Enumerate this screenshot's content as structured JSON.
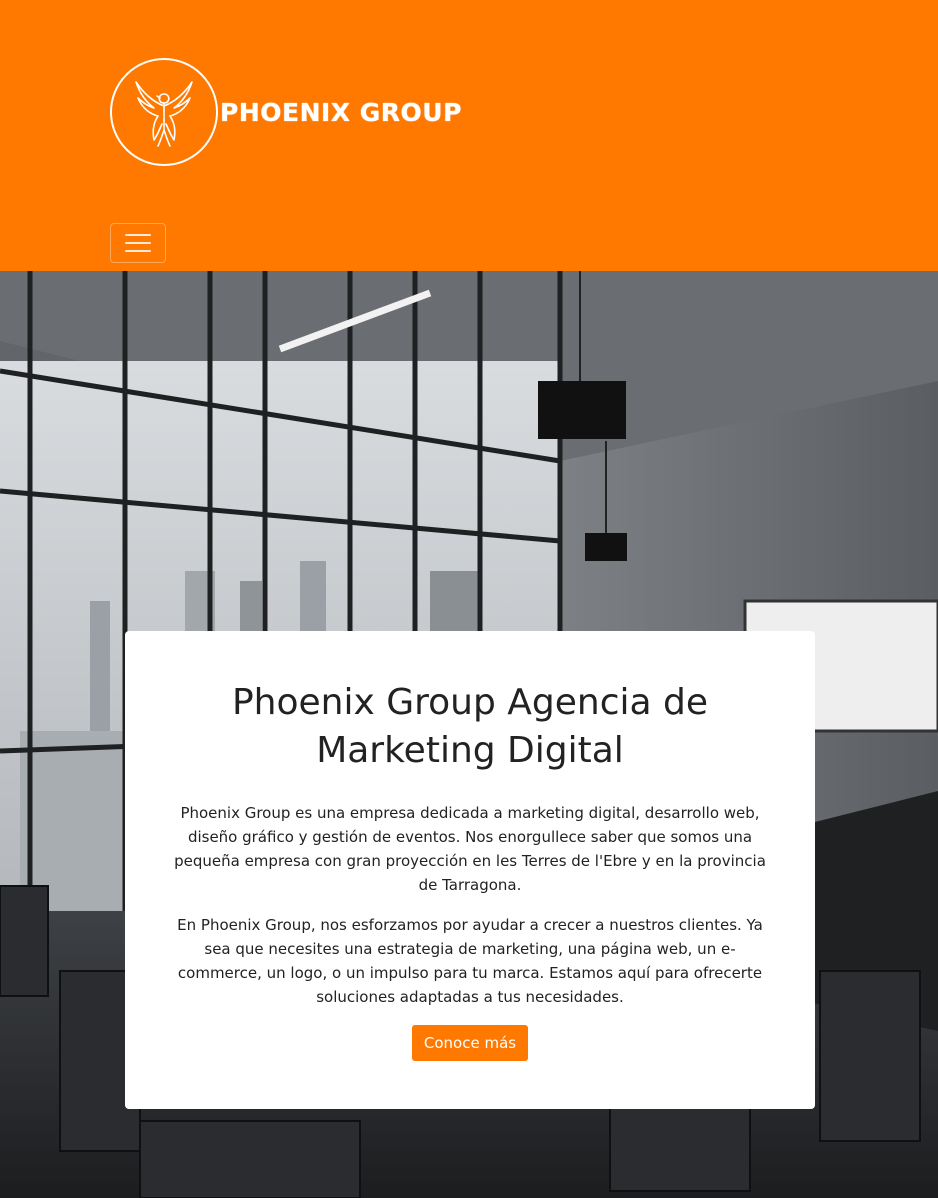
{
  "header": {
    "brand_name": "PHOENIX GROUP",
    "logo_icon": "phoenix-bird-icon",
    "menu_icon": "hamburger-menu-icon",
    "bg_color": "#ff7800"
  },
  "hero": {
    "background": "office meeting room photo",
    "title": "Phoenix Group Agencia de Marketing Digital",
    "paragraph_1": "Phoenix Group es una empresa dedicada a marketing digital, desarrollo web, diseño gráfico y gestión de eventos. Nos enorgullece saber que somos una pequeña empresa con gran proyección en les Terres de l'Ebre y en la provincia de Tarragona.",
    "paragraph_2": "En Phoenix Group, nos esforzamos por ayudar a crecer a nuestros clientes. Ya sea que necesites una estrategia de marketing, una página web, un e-commerce, un logo, o un impulso para tu marca. Estamos aquí para ofrecerte soluciones adaptadas a tus necesidades.",
    "cta_label": "Conoce más",
    "accent_color": "#ff7800"
  }
}
